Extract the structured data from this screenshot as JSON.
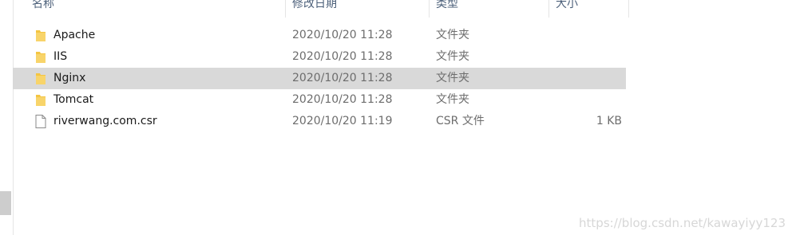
{
  "columns": {
    "name": "名称",
    "date": "修改日期",
    "type": "类型",
    "size": "大小"
  },
  "files": [
    {
      "name": "Apache",
      "date": "2020/10/20 11:28",
      "type": "文件夹",
      "size": "",
      "icon": "folder-icon",
      "selected": false
    },
    {
      "name": "IIS",
      "date": "2020/10/20 11:28",
      "type": "文件夹",
      "size": "",
      "icon": "folder-icon",
      "selected": false
    },
    {
      "name": "Nginx",
      "date": "2020/10/20 11:28",
      "type": "文件夹",
      "size": "",
      "icon": "folder-icon",
      "selected": true
    },
    {
      "name": "Tomcat",
      "date": "2020/10/20 11:28",
      "type": "文件夹",
      "size": "",
      "icon": "folder-icon",
      "selected": false
    },
    {
      "name": "riverwang.com.csr",
      "date": "2020/10/20 11:19",
      "type": "CSR 文件",
      "size": "1 KB",
      "icon": "file-icon",
      "selected": false
    }
  ],
  "watermark": "https://blog.csdn.net/kawayiyy123",
  "colors": {
    "folder": "#f4c542",
    "selected_row": "#d9d9d9",
    "header_text": "#4c607a"
  }
}
